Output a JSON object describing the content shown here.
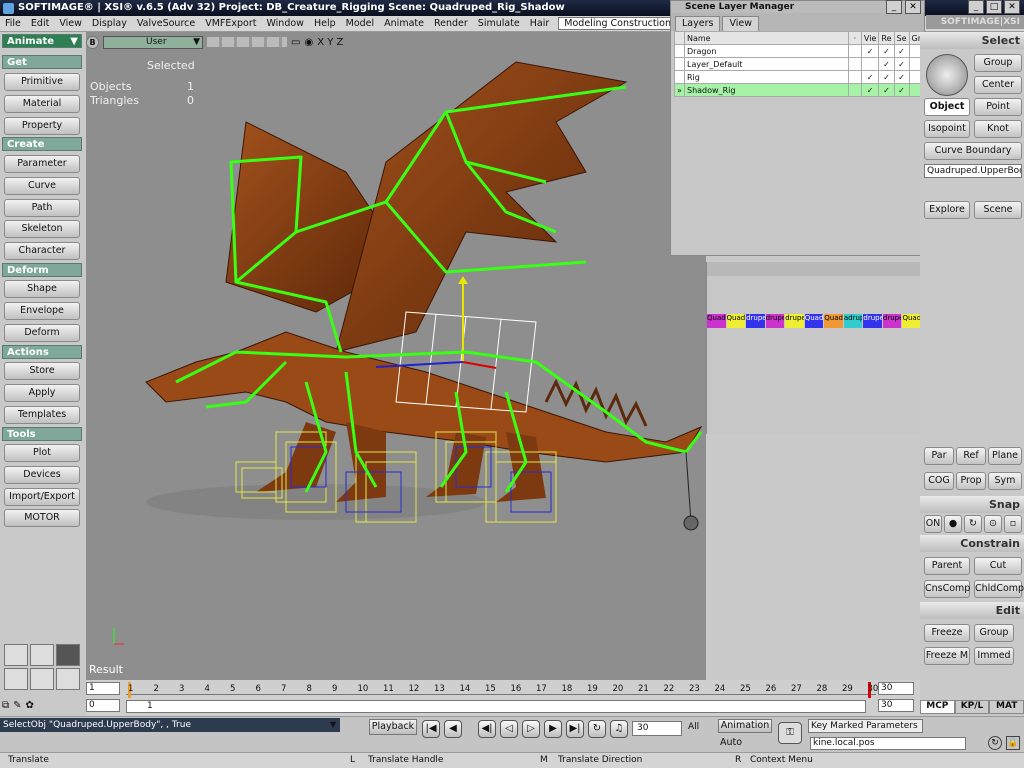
{
  "titlebar": {
    "text": "SOFTIMAGE® | XSI® v.6.5 (Adv 32) Project: DB_Creature_Rigging    Scene: Quadruped_Rig_Shadow"
  },
  "menubar": {
    "items": [
      "File",
      "Edit",
      "View",
      "Display",
      "ValveSource",
      "VMFExport",
      "Window",
      "Help",
      "Model",
      "Animate",
      "Render",
      "Simulate",
      "Hair"
    ],
    "mode": "Modeling Construction Mode"
  },
  "left": {
    "module": "Animate",
    "get_hdr": "Get",
    "get": [
      "Primitive",
      "Material",
      "Property"
    ],
    "create_hdr": "Create",
    "create": [
      "Parameter",
      "Curve",
      "Path",
      "Skeleton",
      "Character"
    ],
    "deform_hdr": "Deform",
    "deform": [
      "Shape",
      "Envelope",
      "Deform"
    ],
    "actions_hdr": "Actions",
    "actions": [
      "Store",
      "Apply",
      "Templates"
    ],
    "tools_hdr": "Tools",
    "tools": [
      "Plot",
      "Devices",
      "Import/Export",
      "MOTOR"
    ]
  },
  "viewport": {
    "letter": "B",
    "camera": "User",
    "axes": "X Y Z",
    "selected_label": "Selected",
    "objects_label": "Objects",
    "objects_value": "1",
    "triangles_label": "Triangles",
    "triangles_value": "0",
    "result": "Result"
  },
  "layer_manager": {
    "title": "Scene Layer Manager",
    "tabs": [
      "Layers",
      "View"
    ],
    "cols": [
      "Name",
      "Vie",
      "Re",
      "Se",
      "Gr"
    ],
    "rows": [
      {
        "name": "Dragon",
        "v": "✓",
        "r": "✓",
        "s": "✓"
      },
      {
        "name": "Layer_Default",
        "v": "",
        "r": "✓",
        "s": "✓"
      },
      {
        "name": "Rig",
        "v": "✓",
        "r": "✓",
        "s": "✓"
      },
      {
        "name": "Shadow_Rig",
        "v": "✓",
        "r": "✓",
        "s": "✓"
      }
    ],
    "row_marker": "»"
  },
  "anim": {
    "clips": [
      "Quadrupe",
      "Quadrupe",
      "druped_U",
      "druped_",
      "druped_U",
      "Quadrupe",
      "Quadrupe",
      "adrupe",
      "druped_",
      "druped_U",
      "Quadrupe"
    ]
  },
  "right": {
    "logo": "SOFTIMAGE|XSI",
    "select_hdr": "Select",
    "group": "Group",
    "center": "Center",
    "object": "Object",
    "point": "Point",
    "isopoint": "Isopoint",
    "knot": "Knot",
    "curve_boundary": "Curve Boundary",
    "selection": "Quadruped.UpperBod",
    "explore": "Explore",
    "scene": "Scene",
    "par": "Par",
    "ref": "Ref",
    "plane": "Plane",
    "cog": "COG",
    "prop": "Prop",
    "sym": "Sym",
    "snap_hdr": "Snap",
    "on": "ON",
    "constrain_hdr": "Constrain",
    "parent": "Parent",
    "cut": "Cut",
    "cnscomp": "CnsComp",
    "chldcomp": "ChldComp",
    "edit_hdr": "Edit",
    "freeze": "Freeze",
    "group2": "Group",
    "freezem": "Freeze M",
    "immed": "Immed",
    "tabs": [
      "MCP",
      "KP/L",
      "MAT"
    ]
  },
  "timeline": {
    "start": "1",
    "current": "0",
    "ticks": [
      "1",
      "2",
      "3",
      "4",
      "5",
      "6",
      "7",
      "8",
      "9",
      "10",
      "11",
      "12",
      "13",
      "14",
      "15",
      "16",
      "17",
      "18",
      "19",
      "20",
      "21",
      "22",
      "23",
      "24",
      "25",
      "26",
      "27",
      "28",
      "29",
      "30"
    ],
    "end_top": "30",
    "end_bottom": "30",
    "left_val": "1"
  },
  "playback": {
    "cmd": "SelectObj \"Quadruped.UpperBody\", , True",
    "playback": "Playback",
    "frame": "30",
    "all": "All",
    "animation": "Animation",
    "auto": "Auto",
    "key_marked": "Key Marked Parameters",
    "kine": "kine.local.pos"
  },
  "status": {
    "left": "Translate",
    "mid": "Translate Handle",
    "mid_key": "L",
    "right": "Translate Direction",
    "right_key": "M",
    "ctx": "Context Menu",
    "ctx_key": "R"
  },
  "colors": {
    "header_green": "#7fa89a",
    "rig_green": "#39ff14",
    "dragon_brown": "#8b3f12",
    "viewport_gray": "#8e8e8e",
    "selected_row": "#a6f2a6"
  }
}
